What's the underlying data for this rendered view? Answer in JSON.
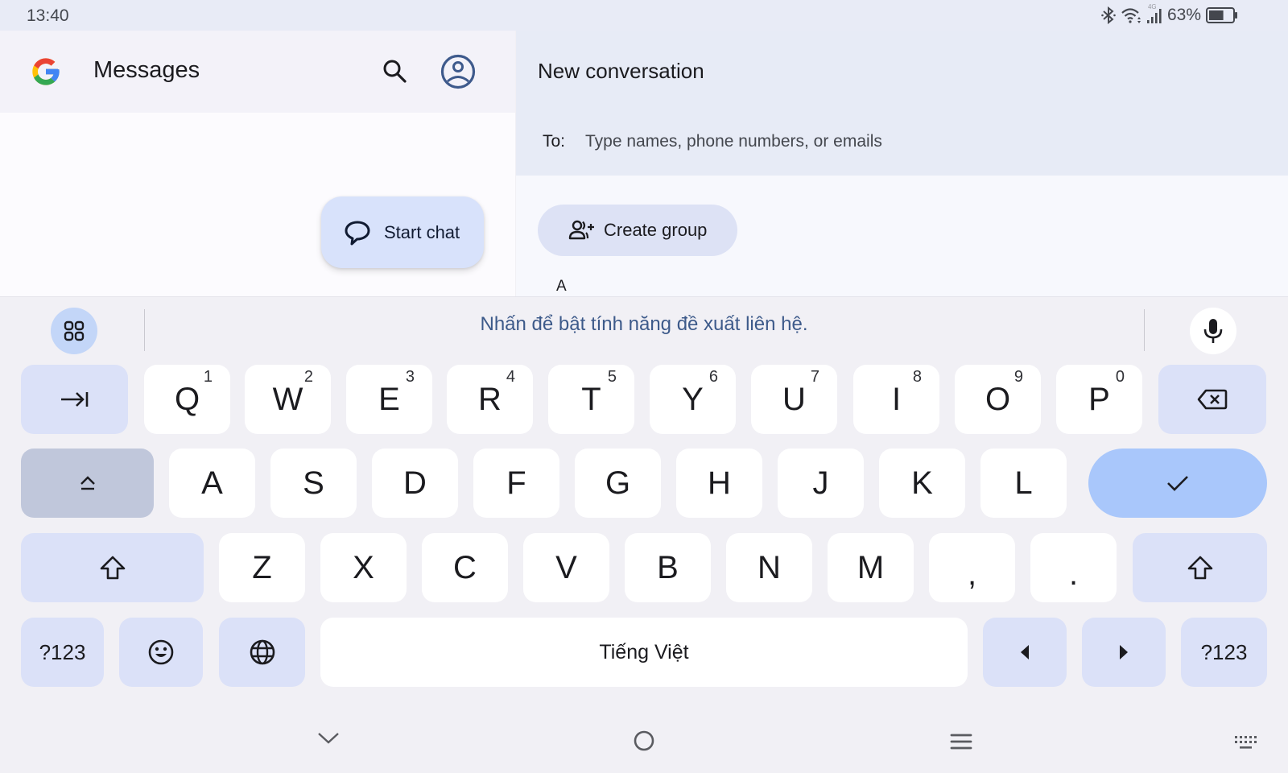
{
  "status_bar": {
    "time": "13:40",
    "network_type": "4G",
    "battery_percent": "63%",
    "battery_level": 0.63,
    "icons": [
      "bluetooth-icon",
      "wifi-icon",
      "cellular-signal-icon",
      "battery-icon"
    ]
  },
  "left_pane": {
    "app_title": "Messages",
    "logo": "google-g-logo",
    "header_icons": [
      "search-icon",
      "account-circle-icon"
    ],
    "start_chat_label": "Start chat"
  },
  "right_pane": {
    "title": "New conversation",
    "to_label": "To:",
    "to_value": "",
    "to_placeholder": "Type names, phone numbers, or emails",
    "create_group_label": "Create group",
    "section_letter": "A"
  },
  "keyboard": {
    "suggestion_text": "Nhấn để bật tính năng đề xuất liên hệ.",
    "rows": [
      [
        {
          "id": "tab",
          "icon": "tab-icon",
          "type": "fn"
        },
        {
          "label": "Q",
          "hint": "1"
        },
        {
          "label": "W",
          "hint": "2"
        },
        {
          "label": "E",
          "hint": "3"
        },
        {
          "label": "R",
          "hint": "4"
        },
        {
          "label": "T",
          "hint": "5"
        },
        {
          "label": "Y",
          "hint": "6"
        },
        {
          "label": "U",
          "hint": "7"
        },
        {
          "label": "I",
          "hint": "8"
        },
        {
          "label": "O",
          "hint": "9"
        },
        {
          "label": "P",
          "hint": "0"
        },
        {
          "id": "backspace",
          "icon": "backspace-icon",
          "type": "fn"
        }
      ],
      [
        {
          "id": "caps-lock",
          "icon": "caps-lock-icon",
          "type": "caps"
        },
        {
          "label": "A"
        },
        {
          "label": "S"
        },
        {
          "label": "D"
        },
        {
          "label": "F"
        },
        {
          "label": "G"
        },
        {
          "label": "H"
        },
        {
          "label": "J"
        },
        {
          "label": "K"
        },
        {
          "label": "L"
        },
        {
          "id": "enter",
          "icon": "checkmark-icon",
          "type": "enter"
        }
      ],
      [
        {
          "id": "shift-left",
          "icon": "shift-icon",
          "type": "fn"
        },
        {
          "label": "Z"
        },
        {
          "label": "X"
        },
        {
          "label": "C"
        },
        {
          "label": "V"
        },
        {
          "label": "B"
        },
        {
          "label": "N"
        },
        {
          "label": "M"
        },
        {
          "label": ","
        },
        {
          "label": "."
        },
        {
          "id": "shift-right",
          "icon": "shift-icon",
          "type": "fn"
        }
      ],
      [
        {
          "id": "symbols-left",
          "label": "?123",
          "type": "fn"
        },
        {
          "id": "emoji",
          "icon": "emoji-icon",
          "type": "fn"
        },
        {
          "id": "language",
          "icon": "globe-icon",
          "type": "fn"
        },
        {
          "id": "space",
          "label": "Tiếng Việt"
        },
        {
          "id": "cursor-left",
          "icon": "arrow-left-icon",
          "type": "fn"
        },
        {
          "id": "cursor-right",
          "icon": "arrow-right-icon",
          "type": "fn"
        },
        {
          "id": "symbols-right",
          "label": "?123",
          "type": "fn"
        }
      ]
    ]
  },
  "nav_bar": {
    "icons": [
      "hide-keyboard-chevron-icon",
      "home-icon",
      "recents-icon",
      "keyboard-switcher-icon"
    ]
  }
}
